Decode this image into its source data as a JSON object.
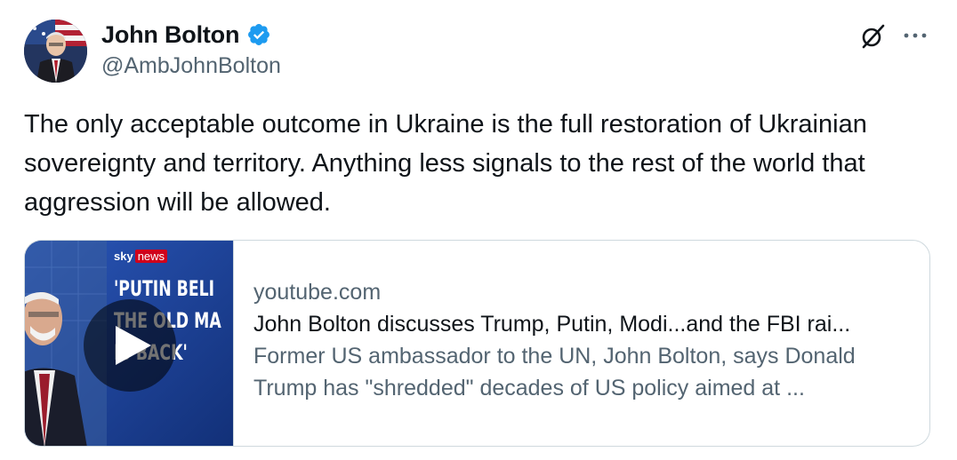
{
  "author": {
    "display_name": "John Bolton",
    "handle": "@AmbJohnBolton",
    "verified": true,
    "avatar_icon": "avatar-photo"
  },
  "actions": {
    "grok_icon": "grok-icon",
    "more_icon": "more-icon"
  },
  "tweet": {
    "text": "The only acceptable outcome in Ukraine is the full restoration of Ukrainian sovereignty and territory. Anything less signals to the rest of the world that aggression will be allowed."
  },
  "link_card": {
    "thumbnail": {
      "brand_sky": "sky",
      "brand_news": "news",
      "headline": "'PUTIN BELI\nTHE OLD MA\nIS BACK'"
    },
    "domain": "youtube.com",
    "title": "John Bolton discusses Trump, Putin, Modi...and the FBI rai...",
    "description": "Former US ambassador to the UN, John Bolton, says Donald Trump has \"shredded\" decades of US policy aimed at ..."
  },
  "colors": {
    "text_primary": "#0f1419",
    "text_secondary": "#536471",
    "verified_blue": "#1d9bf0",
    "card_border": "#cfd9de",
    "sky_news_red": "#d0021b",
    "thumbnail_blue": "#1a3c8c"
  }
}
